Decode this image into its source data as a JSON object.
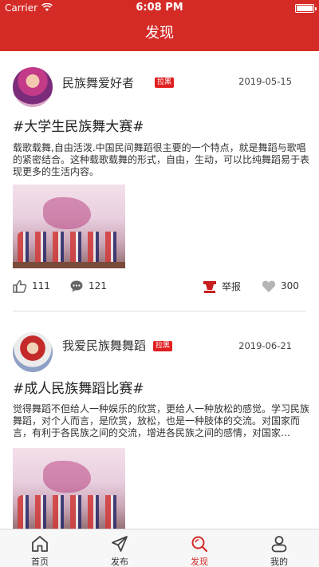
{
  "status_bar": {
    "carrier": "Carrier",
    "time": "6:08 PM"
  },
  "header": {
    "title": "发现"
  },
  "colors": {
    "brand": "#d42b27",
    "badge": "#e02020",
    "divider": "#dddddd"
  },
  "posts": [
    {
      "username": "民族舞爱好者",
      "badge": "拉黑",
      "date": "2019-05-15",
      "topic": "#大学生民族舞大赛#",
      "body": "载歌载舞,自由活泼.中国民间舞蹈很主要的一个特点，就是舞蹈与歌唱的紧密结合。这种载歌载舞的形式，自由，生动，可以比纯舞蹈易于表现更多的生活内容。",
      "likes": "111",
      "comments": "121",
      "report_label": "举报",
      "favorites": "300"
    },
    {
      "username": "我爱民族舞舞蹈",
      "badge": "拉黑",
      "date": "2019-06-21",
      "topic": "#成人民族舞蹈比赛#",
      "body": "觉得舞蹈不但给人一种娱乐的欣赏，更给人一种放松的感觉。学习民族舞蹈，对个人而言，是欣赏，放松，也是一种肢体的交流。对国家而言，有利于各民族之间的交流，增进各民族之间的感情，对国家…"
    }
  ],
  "tabs": [
    {
      "label": "首页",
      "icon": "home-icon"
    },
    {
      "label": "发布",
      "icon": "send-icon"
    },
    {
      "label": "发现",
      "icon": "search-icon",
      "active": true
    },
    {
      "label": "我的",
      "icon": "profile-icon"
    }
  ]
}
